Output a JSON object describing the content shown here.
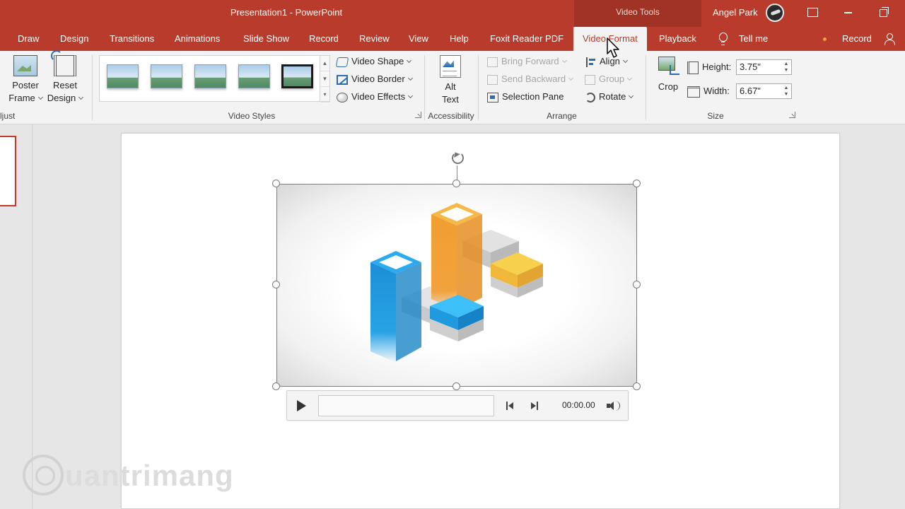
{
  "titlebar": {
    "title": "Presentation1  -  PowerPoint",
    "context_tab": "Video Tools",
    "user": "Angel Park"
  },
  "tabs": [
    {
      "label": "Draw"
    },
    {
      "label": "Design"
    },
    {
      "label": "Transitions"
    },
    {
      "label": "Animations"
    },
    {
      "label": "Slide Show"
    },
    {
      "label": "Record"
    },
    {
      "label": "Review"
    },
    {
      "label": "View"
    },
    {
      "label": "Help"
    },
    {
      "label": "Foxit Reader PDF"
    },
    {
      "label": "Video Format",
      "active": true
    },
    {
      "label": "Playback"
    }
  ],
  "tell_me": "Tell me",
  "record_btn": "Record",
  "ribbon": {
    "adjust": {
      "label": "ljust",
      "poster_frame": [
        "Poster",
        "Frame"
      ],
      "reset_design": [
        "Reset",
        "Design"
      ]
    },
    "video_styles": {
      "label": "Video Styles",
      "video_shape": "Video Shape",
      "video_border": "Video Border",
      "video_effects": "Video Effects"
    },
    "accessibility": {
      "label": "Accessibility",
      "alt_text": [
        "Alt",
        "Text"
      ]
    },
    "arrange": {
      "label": "Arrange",
      "bring_forward": "Bring Forward",
      "send_backward": "Send Backward",
      "selection_pane": "Selection Pane",
      "align": "Align",
      "group": "Group",
      "rotate": "Rotate"
    },
    "size": {
      "label": "Size",
      "crop": "Crop",
      "height_label": "Height:",
      "height_value": "3.75\"",
      "width_label": "Width:",
      "width_value": "6.67\""
    }
  },
  "media": {
    "time": "00:00.00"
  },
  "watermark": {
    "text": "uantrimang"
  },
  "colors": {
    "accent": "#b83b2b",
    "cube_blue": "#29a3e6",
    "cube_orange": "#f2a23c",
    "cube_yellow": "#f7c84a",
    "cube_gray": "#d4d4d4"
  }
}
